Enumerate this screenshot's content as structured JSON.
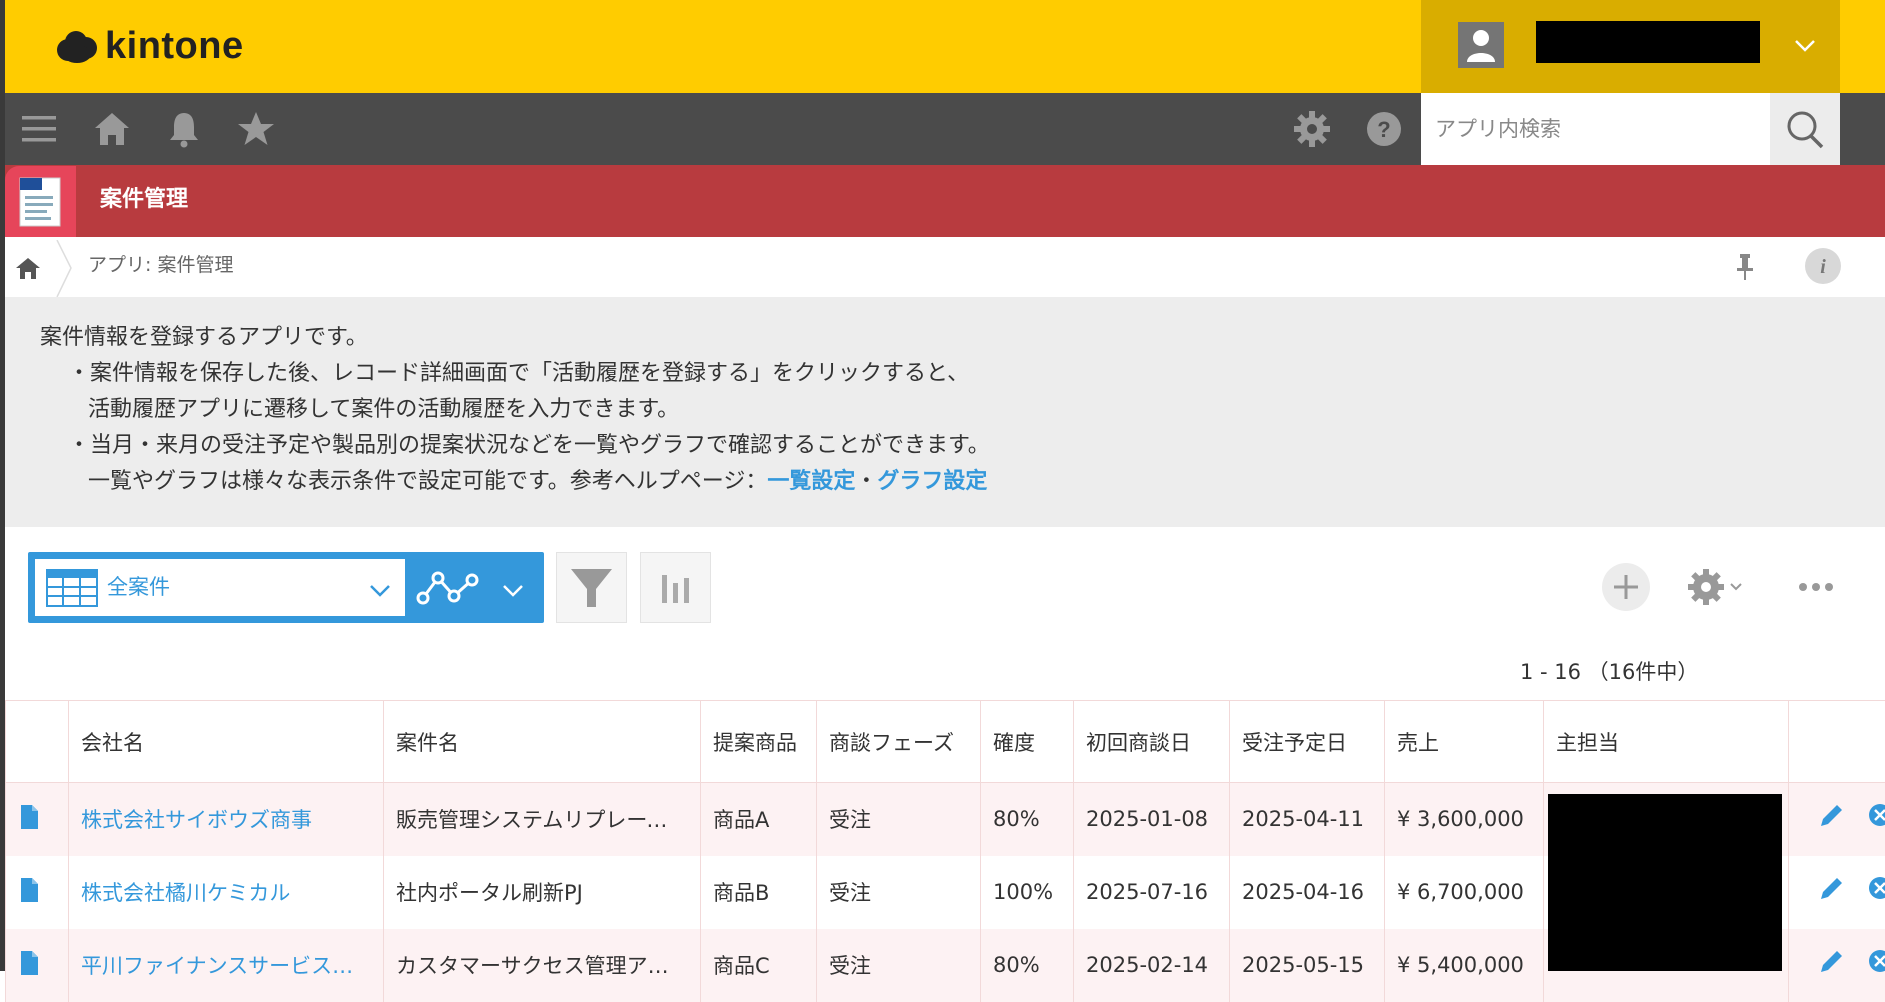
{
  "header": {
    "logo_text": "kintone",
    "user_menu": {
      "avatar": "user-avatar-icon",
      "chevron": "chevron-down-icon"
    }
  },
  "global_nav": {
    "icons": [
      "menu-icon",
      "home-icon",
      "bell-icon",
      "star-icon",
      "gear-icon",
      "help-icon"
    ],
    "search": {
      "placeholder": "アプリ内検索",
      "value": ""
    }
  },
  "app": {
    "title": "案件管理",
    "icon": "document-icon"
  },
  "breadcrumb": {
    "text": "アプリ: 案件管理"
  },
  "description": {
    "line1": "案件情報を登録するアプリです。",
    "line2": "・案件情報を保存した後、レコード詳細画面で「活動履歴を登録する」をクリックすると、",
    "line3": "活動履歴アプリに遷移して案件の活動履歴を入力できます。",
    "line4": "・当月・来月の受注予定や製品別の提案状況などを一覧やグラフで確認することができます。",
    "line5_prefix": "一覧やグラフは様々な表示条件で設定可能です。参考ヘルプページ：",
    "link1": "一覧設定",
    "separator": "・",
    "link2": "グラフ設定"
  },
  "toolbar": {
    "view_name": "全案件",
    "count_text": "1 - 16 （16件中）"
  },
  "table": {
    "columns": [
      "",
      "会社名",
      "案件名",
      "提案商品",
      "商談フェーズ",
      "確度",
      "初回商談日",
      "受注予定日",
      "売上",
      "主担当",
      ""
    ],
    "rows": [
      {
        "company": "株式会社サイボウズ商事",
        "deal": "販売管理システムリプレース案件",
        "product": "商品A",
        "phase": "受注",
        "probability": "80%",
        "first_meeting": "2025-01-08",
        "order_date": "2025-04-11",
        "sales": "¥ 3,600,000"
      },
      {
        "company": "株式会社橘川ケミカル",
        "deal": "社内ポータル刷新PJ",
        "product": "商品B",
        "phase": "受注",
        "probability": "100%",
        "first_meeting": "2025-07-16",
        "order_date": "2025-04-16",
        "sales": "¥ 6,700,000"
      },
      {
        "company": "平川ファイナンスサービス株式会社",
        "deal": "カスタマーサクセス管理アプリ導入",
        "product": "商品C",
        "phase": "受注",
        "probability": "80%",
        "first_meeting": "2025-02-14",
        "order_date": "2025-05-15",
        "sales": "¥ 5,400,000"
      }
    ]
  },
  "colors": {
    "header_yellow": "#ffcc00",
    "nav_gray": "#4b4b4b",
    "app_red": "#b83b3f",
    "link_blue": "#3498db"
  }
}
